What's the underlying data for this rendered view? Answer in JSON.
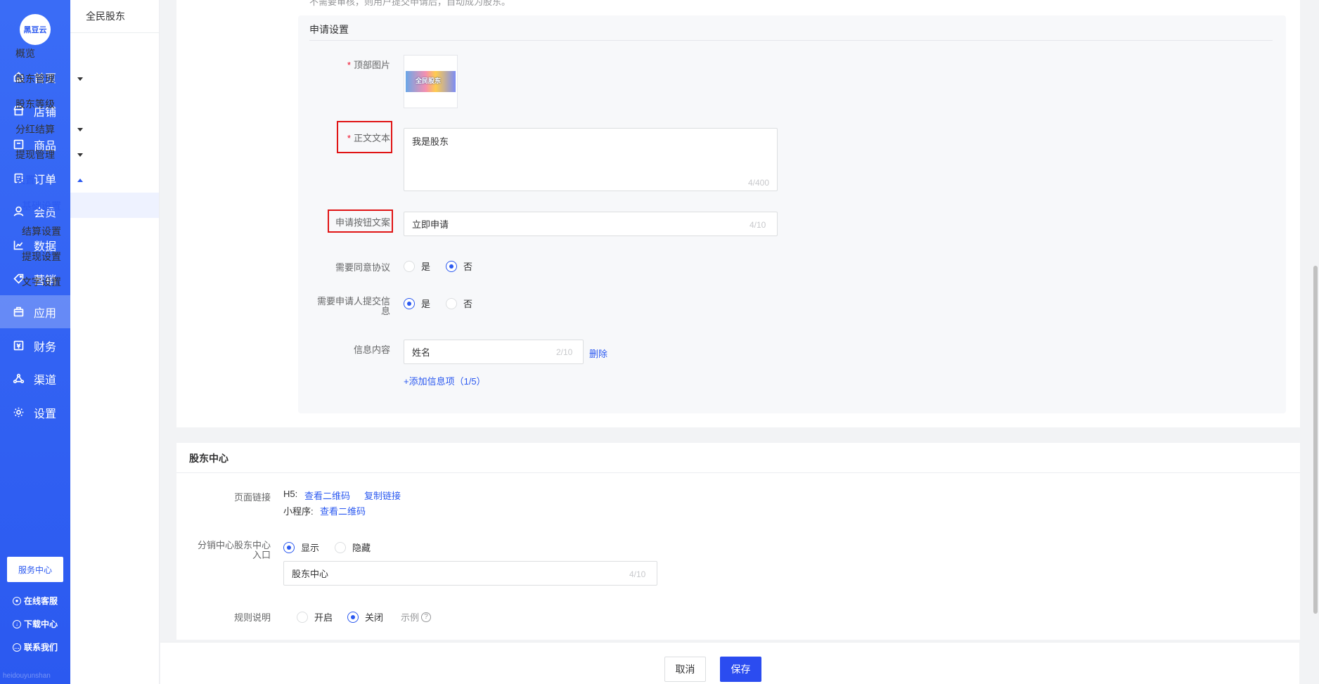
{
  "logo": "黑豆云",
  "nav1": [
    {
      "label": "首页",
      "icon": "home-icon"
    },
    {
      "label": "店铺",
      "icon": "shop-icon"
    },
    {
      "label": "商品",
      "icon": "goods-icon"
    },
    {
      "label": "订单",
      "icon": "order-icon"
    },
    {
      "label": "会员",
      "icon": "member-icon"
    },
    {
      "label": "数据",
      "icon": "chart-icon"
    },
    {
      "label": "营销",
      "icon": "tag-icon"
    },
    {
      "label": "应用",
      "icon": "app-icon"
    },
    {
      "label": "财务",
      "icon": "finance-icon"
    },
    {
      "label": "渠道",
      "icon": "channel-icon"
    },
    {
      "label": "设置",
      "icon": "gear-icon"
    }
  ],
  "service_center": "服务中心",
  "nav1_links": [
    "在线客服",
    "下载中心",
    "联系我们"
  ],
  "watermark": "heidouyunshan",
  "nav2": {
    "title": "全民股东",
    "items": [
      "概览",
      "股东管理",
      "股东等级",
      "分红结算",
      "提现管理",
      "设置"
    ],
    "sub": [
      "基础设置",
      "结算设置",
      "提现设置",
      "文字设置"
    ]
  },
  "form": {
    "top_note": "不需要审核，则用户提交申请后，自动成为股东。",
    "section_title": "申请设置",
    "top_image_label": "顶部图片",
    "top_image_text": "全民股东",
    "body_label": "正文文本",
    "body_value": "我是股东",
    "body_counter": "4/400",
    "btn_text_label": "申请按钮文案",
    "btn_text_value": "立即申请",
    "btn_text_counter": "4/10",
    "agree_label": "需要同意协议",
    "agree_yes": "是",
    "agree_no": "否",
    "submit_info_label": "需要申请人提交信息",
    "submit_yes": "是",
    "submit_no": "否",
    "info_label": "信息内容",
    "info_value": "姓名",
    "info_counter": "2/10",
    "delete": "删除",
    "add_info": "+添加信息项（1/5）"
  },
  "center": {
    "title": "股东中心",
    "page_link_label": "页面链接",
    "h5": "H5:",
    "view_qr": "查看二维码",
    "copy_link": "复制链接",
    "mini": "小程序:",
    "view_qr2": "查看二维码",
    "entry_label": "分销中心股东中心入口",
    "show": "显示",
    "hide": "隐藏",
    "entry_value": "股东中心",
    "entry_counter": "4/10",
    "rule_label": "规则说明",
    "open": "开启",
    "close": "关闭",
    "example": "示例"
  },
  "footer": {
    "cancel": "取消",
    "save": "保存"
  },
  "colors": {
    "primary": "#2b59f0",
    "highlight": "#e01414"
  }
}
